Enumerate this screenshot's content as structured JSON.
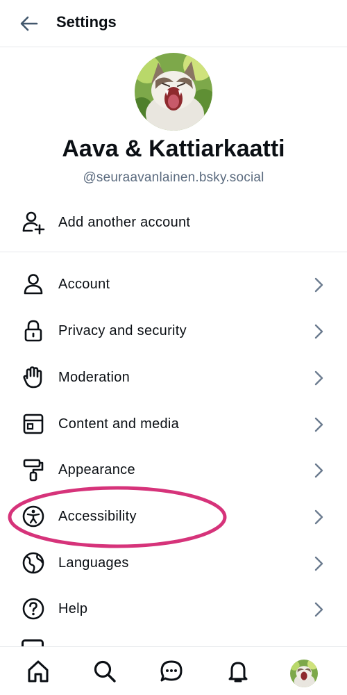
{
  "header": {
    "title": "Settings",
    "back_icon": "arrow-left-icon"
  },
  "profile": {
    "display_name": "Aava & Kattiarkaatti",
    "handle": "@seuraavanlainen.bsky.social",
    "avatar_icon": "cat-avatar"
  },
  "add_account": {
    "label": "Add another account",
    "icon": "person-plus-icon"
  },
  "menu": {
    "items": [
      {
        "label": "Account",
        "icon": "person-icon"
      },
      {
        "label": "Privacy and security",
        "icon": "lock-icon"
      },
      {
        "label": "Moderation",
        "icon": "hand-icon"
      },
      {
        "label": "Content and media",
        "icon": "window-icon"
      },
      {
        "label": "Appearance",
        "icon": "paint-roller-icon"
      },
      {
        "label": "Accessibility",
        "icon": "accessibility-icon"
      },
      {
        "label": "Languages",
        "icon": "globe-icon"
      },
      {
        "label": "Help",
        "icon": "question-icon"
      }
    ]
  },
  "annotation": {
    "highlighted_item": "Accessibility",
    "color": "#d6337a"
  },
  "bottom_nav": {
    "items": [
      "home-icon",
      "search-icon",
      "chat-icon",
      "bell-icon",
      "profile-avatar"
    ]
  },
  "colors": {
    "text": "#0b0f14",
    "muted": "#5b6b7f",
    "divider": "#e6e8eb",
    "chevron": "#6b7b8f",
    "back_arrow": "#42576c"
  }
}
